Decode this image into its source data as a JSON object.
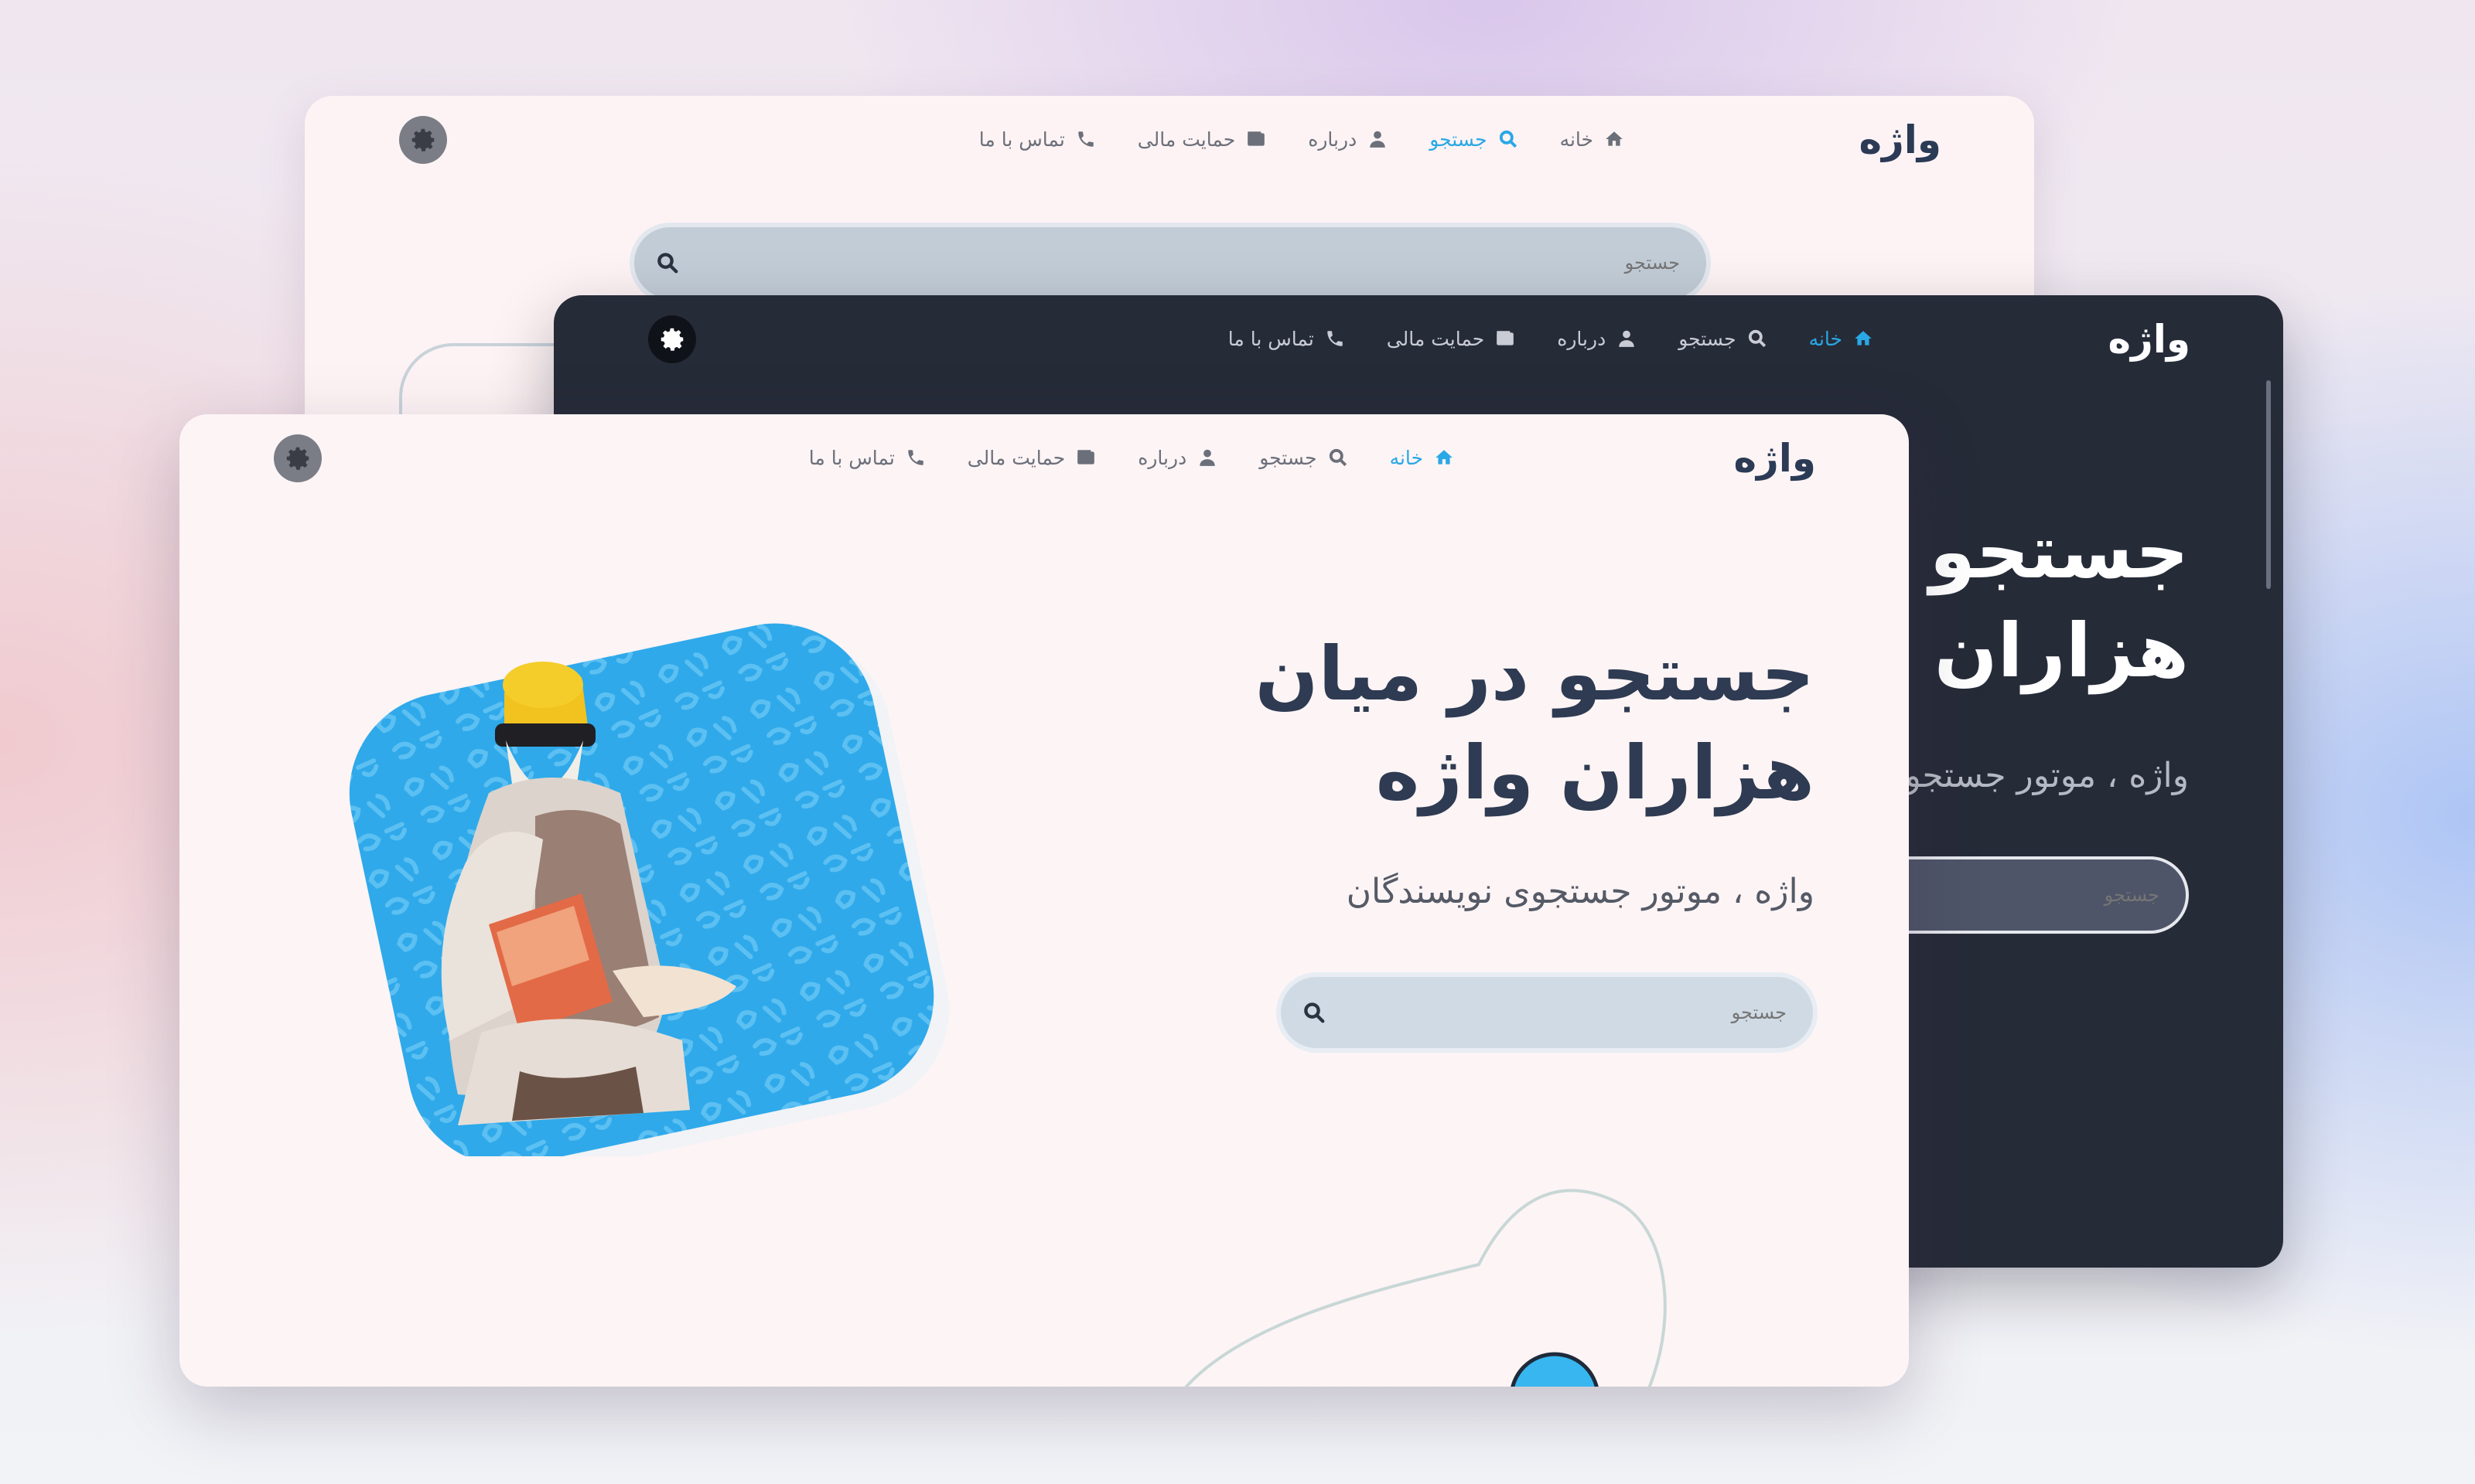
{
  "app": {
    "logo": "واژه"
  },
  "nav": {
    "items": [
      {
        "label": "خانه",
        "icon": "home-icon"
      },
      {
        "label": "جستجو",
        "icon": "search-icon"
      },
      {
        "label": "درباره",
        "icon": "user-icon"
      },
      {
        "label": "حمایت مالی",
        "icon": "wallet-icon"
      },
      {
        "label": "تماس با ما",
        "icon": "phone-icon"
      }
    ],
    "active_back": "جستجو",
    "active_mid": "خانه",
    "active_front": "خانه"
  },
  "theme_toggle": {
    "icon": "gear-icon"
  },
  "hero": {
    "title_line1": "جستجو در میان",
    "title_line2": "هزاران واژه",
    "subtitle": "واژه ، موتور جستجوی نویسندگان"
  },
  "search": {
    "placeholder": "جستجو"
  },
  "colors": {
    "accent": "#29a8e6",
    "title": "#2e3b52",
    "dark_bg": "#262b38",
    "light_bg": "#fdf4f5"
  }
}
